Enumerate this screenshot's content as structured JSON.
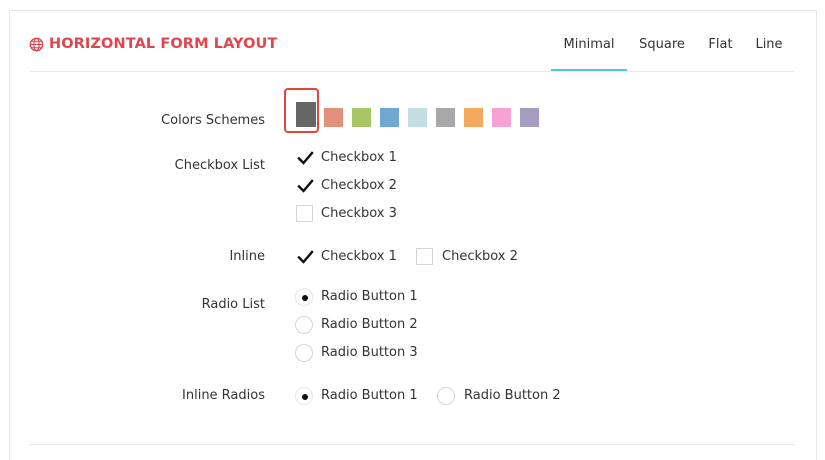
{
  "header": {
    "title": "HORIZONTAL FORM LAYOUT",
    "tabs": [
      {
        "label": "Minimal",
        "active": true
      },
      {
        "label": "Square",
        "active": false
      },
      {
        "label": "Flat",
        "active": false
      },
      {
        "label": "Line",
        "active": false
      }
    ]
  },
  "form": {
    "colors_label": "Colors Schemes",
    "color_swatches": [
      "#666666",
      "#e2927b",
      "#a6c763",
      "#6fa8d1",
      "#c4dde3",
      "#a8a8a8",
      "#f5a95e",
      "#f6a3d3",
      "#a69ec1"
    ],
    "selected_color": "#666666",
    "checkbox_list_label": "Checkbox List",
    "checkbox_list": [
      {
        "label": "Checkbox 1",
        "checked": true
      },
      {
        "label": "Checkbox 2",
        "checked": true
      },
      {
        "label": "Checkbox 3",
        "checked": false
      }
    ],
    "inline_label": "Inline",
    "inline_checkboxes": [
      {
        "label": "Checkbox 1",
        "checked": true
      },
      {
        "label": "Checkbox 2",
        "checked": false
      }
    ],
    "radio_list_label": "Radio List",
    "radio_list": [
      {
        "label": "Radio Button 1",
        "checked": true
      },
      {
        "label": "Radio Button 2",
        "checked": false
      },
      {
        "label": "Radio Button 3",
        "checked": false
      }
    ],
    "inline_radios_label": "Inline Radios",
    "inline_radios": [
      {
        "label": "Radio Button 1",
        "checked": true
      },
      {
        "label": "Radio Button 2",
        "checked": false
      }
    ]
  },
  "colors": {
    "accent": "#e0464f",
    "tab_underline": "#5bc4d4"
  }
}
